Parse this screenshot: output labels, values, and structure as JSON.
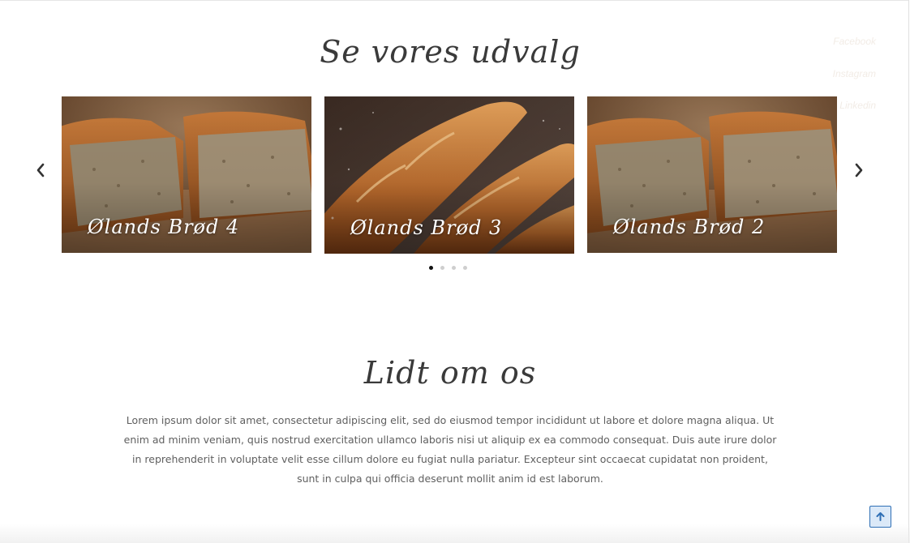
{
  "header": {
    "section_title": "Se vores udvalg"
  },
  "social": {
    "facebook": "Facebook",
    "instagram": "Instagram",
    "linkedin": "Linkedin",
    "icons": [
      "linkedin-icon"
    ]
  },
  "carousel": {
    "prev_icon": "chevron-left-icon",
    "next_icon": "chevron-right-icon",
    "slides": [
      {
        "caption": "Ølands Brød 4",
        "image": "sliced-seed-bread"
      },
      {
        "caption": "Ølands Brød 3",
        "image": "baguettes"
      },
      {
        "caption": "Ølands Brød 2",
        "image": "sliced-seed-bread"
      },
      {
        "caption": "",
        "image": "sliced-seed-bread"
      }
    ],
    "dots": 4,
    "active_dot": 0
  },
  "about": {
    "title": "Lidt om os",
    "text": "Lorem ipsum dolor sit amet, consectetur adipiscing elit, sed do eiusmod tempor incididunt ut labore et dolore magna aliqua. Ut enim ad minim veniam, quis nostrud exercitation ullamco laboris nisi ut aliquip ex ea commodo consequat. Duis aute irure dolor in reprehenderit in voluptate velit esse cillum dolore eu fugiat nulla pariatur. Excepteur sint occaecat cupidatat non proident, sunt in culpa qui officia deserunt mollit anim id est laborum."
  },
  "scroll_top": {
    "icon": "arrow-up-icon"
  },
  "colors": {
    "title": "#3a3a3a",
    "body_text": "#5f5f5f",
    "scroll_button_border": "#2f6fb5",
    "scroll_button_bg": "#dbe9f8",
    "dot_active": "#111111",
    "dot_inactive": "#cfcfcf"
  }
}
